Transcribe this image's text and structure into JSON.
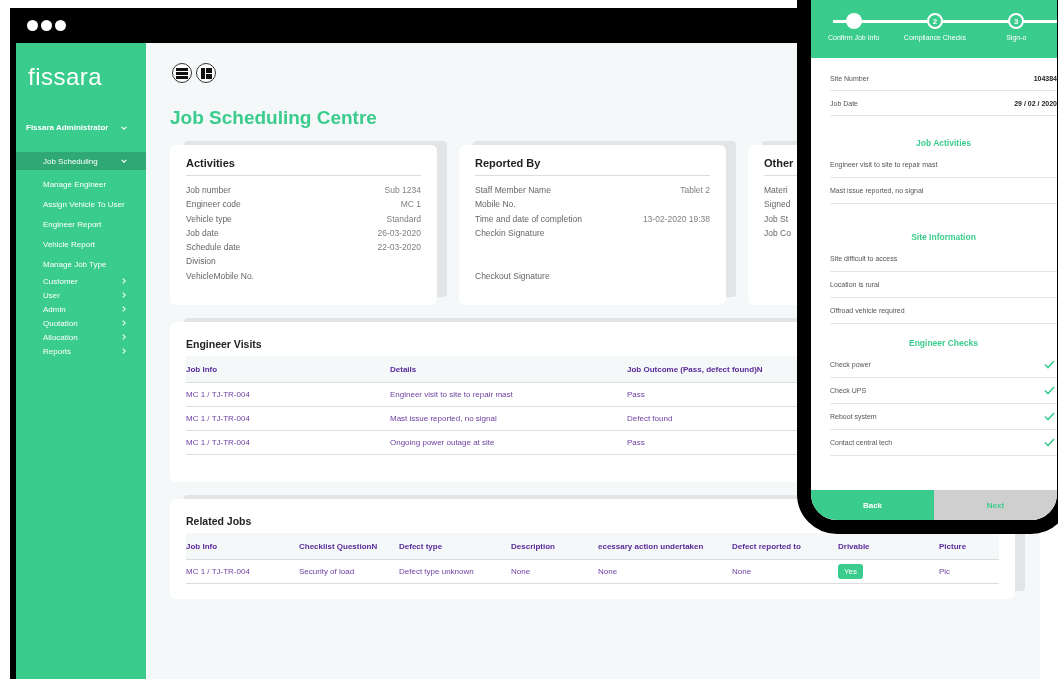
{
  "sidebar": {
    "logo": "fissara",
    "user": {
      "name": "Fissara Administrator"
    },
    "nav": [
      {
        "label": "Job Scheduling",
        "selected": true,
        "expanded": true,
        "children": [
          {
            "label": "Manage Engineer",
            "selected": false
          },
          {
            "label": "Assign Vehicle To User",
            "selected": false
          },
          {
            "label": "Engineer Report",
            "selected": false
          },
          {
            "label": "Vehicle Report",
            "selected": false
          },
          {
            "label": "Manage Job Type",
            "selected": false
          }
        ]
      },
      {
        "label": "Customer",
        "selected": false,
        "expanded": false
      },
      {
        "label": "User",
        "selected": false,
        "expanded": false
      },
      {
        "label": "Admin",
        "selected": false,
        "expanded": false
      },
      {
        "label": "Quotation",
        "selected": false,
        "expanded": false
      },
      {
        "label": "Allocation",
        "selected": false,
        "expanded": false
      },
      {
        "label": "Reports",
        "selected": false,
        "expanded": false
      }
    ]
  },
  "toolbar": {
    "views": [
      {
        "kind": "list",
        "selected": false
      },
      {
        "kind": "grid",
        "selected": false
      }
    ]
  },
  "title": "Job Scheduling Centre",
  "cards": [
    {
      "title": "Activities",
      "fields": [
        {
          "label": "Job number",
          "value": "Sub 1234"
        },
        {
          "label": "Engineer code",
          "value": "MC 1"
        },
        {
          "label": "Vehicle type",
          "value": "Standard"
        },
        {
          "label": "Job date",
          "value": "26-03-2020"
        },
        {
          "label": "Schedule date",
          "value": "22-03-2020"
        },
        {
          "label": "Division"
        },
        {
          "label": "VehicleMobile No."
        }
      ]
    },
    {
      "title": "Reported By",
      "fields": [
        {
          "label": "Staff Member Name",
          "value": "Tablet 2"
        },
        {
          "label": "Mobile No."
        },
        {
          "label": "Time and date of completion",
          "value": "13-02-2020 19:38"
        },
        {
          "label": "Checkin Signature",
          "tall": true
        },
        {
          "label": "Checkout Signature"
        }
      ]
    },
    {
      "title": "Other",
      "fields": [
        {
          "label": "Materi"
        },
        {
          "label": "Signed"
        },
        {
          "label": "Job St"
        },
        {
          "label": "Job Co"
        }
      ]
    }
  ],
  "engineer_visits": {
    "title": "Engineer Visits",
    "columns": [
      "Job Info",
      "Details",
      "Job Outcome (Pass, defect found)N"
    ],
    "rows": [
      [
        "MC 1 / TJ-TR-004",
        "Engineer visit to site to repair mast",
        "Pass"
      ],
      [
        "MC 1 / TJ-TR-004",
        "Mast issue reported, no signal",
        "Defect found"
      ],
      [
        "MC 1 / TJ-TR-004",
        "Ongoing power outage at site",
        "Pass"
      ]
    ]
  },
  "related_jobs": {
    "title": "Related Jobs",
    "columns": [
      {
        "label": "Job Info",
        "kind": "text"
      },
      {
        "label": "Checklist QuestionN",
        "kind": "text"
      },
      {
        "label": "Defect type",
        "kind": "text"
      },
      {
        "label": "Description",
        "kind": "text"
      },
      {
        "label": "ecessary action undertaken",
        "kind": "text"
      },
      {
        "label": "Defect reported to",
        "kind": "text"
      },
      {
        "label": "Drivable",
        "kind": "badge"
      },
      {
        "label": "Picture",
        "kind": "text"
      }
    ],
    "rows": [
      [
        "MC 1 / TJ-TR-004",
        "Security of load",
        "Defect type unknown",
        "None",
        "None",
        "None",
        "Yes",
        "Pic"
      ]
    ]
  },
  "phone": {
    "steps": [
      {
        "label": "Confirm Job Info",
        "completed": true
      },
      {
        "label": "Compliance Checks",
        "number": "2",
        "completed": false
      },
      {
        "label": "Sign-o",
        "number": "3",
        "completed": false
      }
    ],
    "details": [
      {
        "label": "Site Number",
        "value": "104384"
      },
      {
        "label": "Job Date",
        "value": "29 / 02 / 2020"
      }
    ],
    "sections": [
      {
        "title": "Job Activities",
        "items": [
          {
            "label": "Engineer visit to site to repair mast"
          },
          {
            "label": "Mast issue reported, no signal"
          }
        ]
      },
      {
        "title": "Site Information",
        "items": [
          {
            "label": "Site difficult to access"
          },
          {
            "label": "Location is rural"
          },
          {
            "label": "Offroad vehicle required"
          }
        ]
      },
      {
        "title": "Engineer Checks",
        "items": [
          {
            "label": "Check power",
            "checked": true
          },
          {
            "label": "Check UPS",
            "checked": true
          },
          {
            "label": "Reboot system",
            "checked": true
          },
          {
            "label": "Contact central tech",
            "checked": true
          }
        ]
      }
    ],
    "buttons": [
      {
        "label": "Back",
        "disabled": false
      },
      {
        "label": "Next",
        "disabled": true
      }
    ]
  }
}
